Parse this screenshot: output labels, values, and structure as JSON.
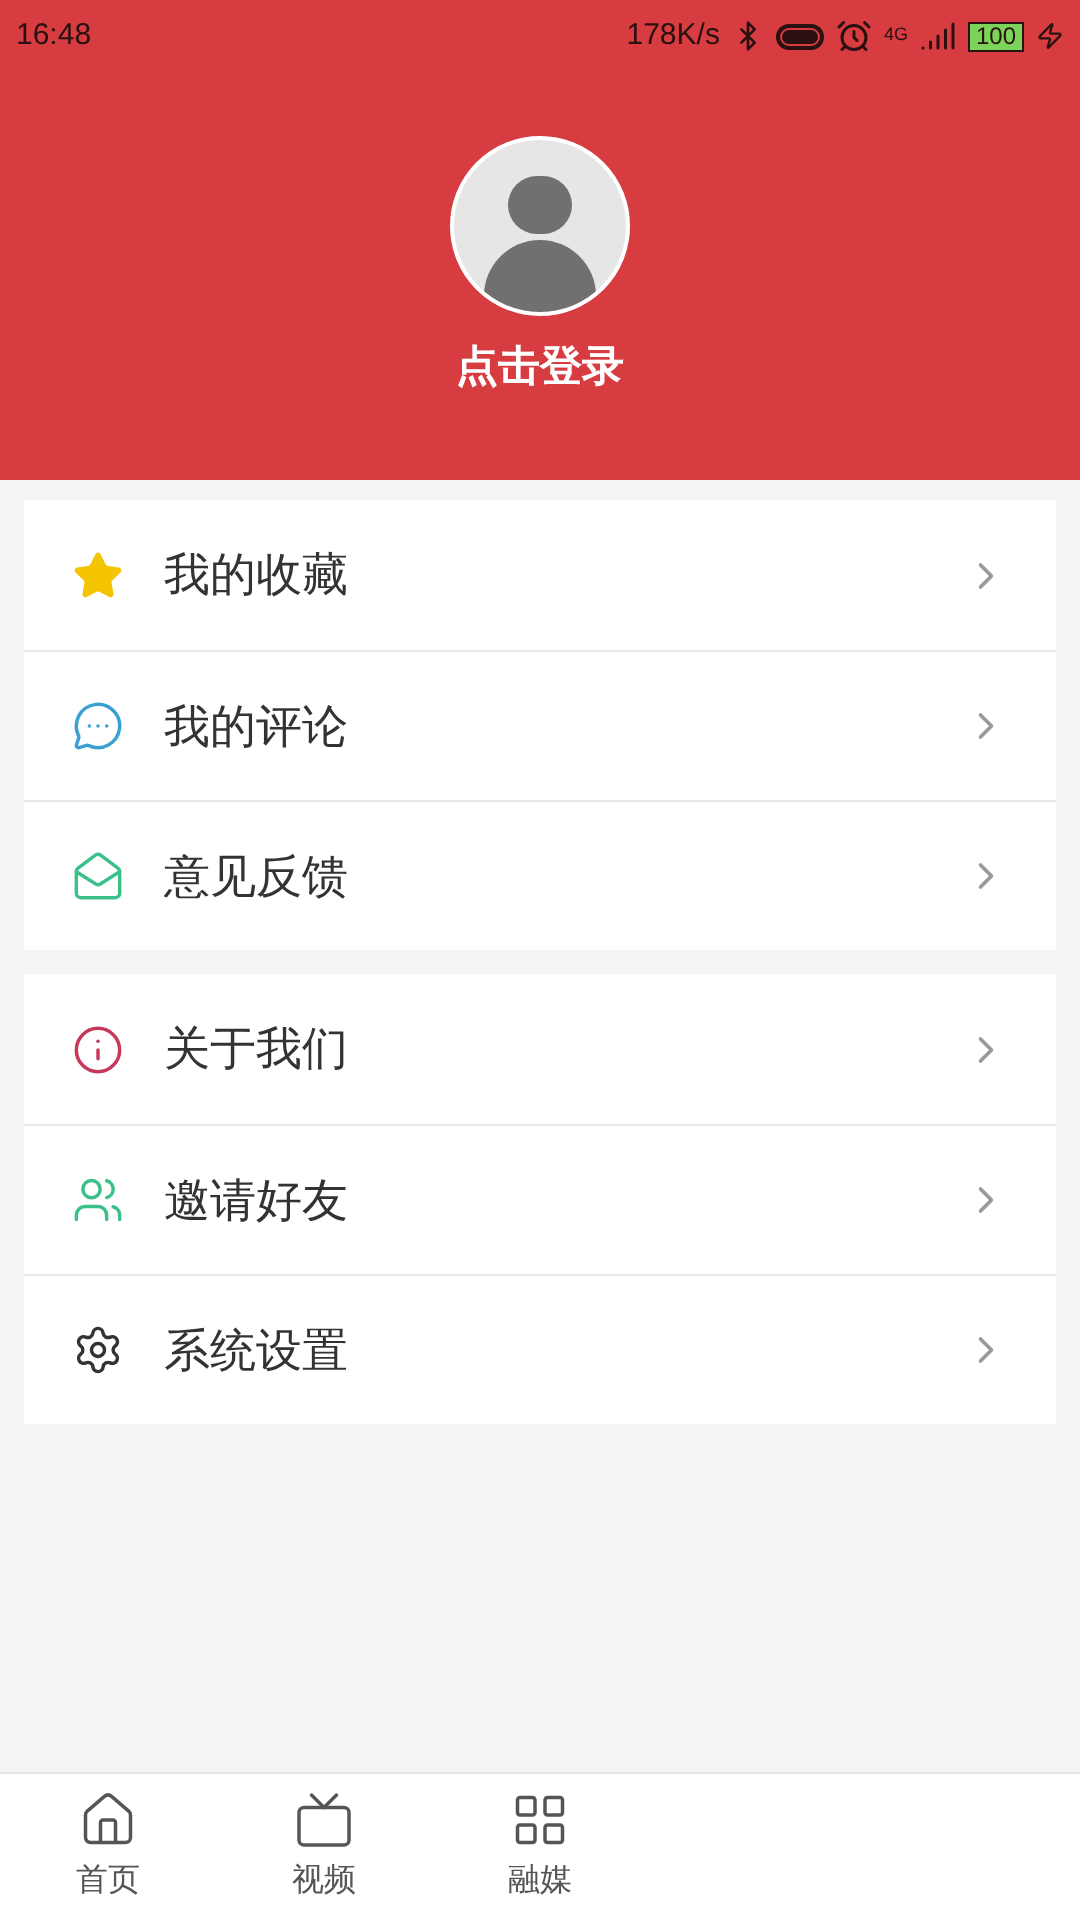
{
  "status_bar": {
    "time": "16:48",
    "speed": "178K/s",
    "network": "4G",
    "battery": "100"
  },
  "profile": {
    "login": "点击登录"
  },
  "menu_groups": [
    [
      {
        "label": "我的收藏"
      },
      {
        "label": "我的评论"
      },
      {
        "label": "意见反馈"
      }
    ],
    [
      {
        "label": "关于我们"
      },
      {
        "label": "邀请好友"
      },
      {
        "label": "系统设置"
      }
    ]
  ],
  "tab_bar": [
    {
      "label": "首页"
    },
    {
      "label": "视频"
    },
    {
      "label": "融媒"
    }
  ]
}
